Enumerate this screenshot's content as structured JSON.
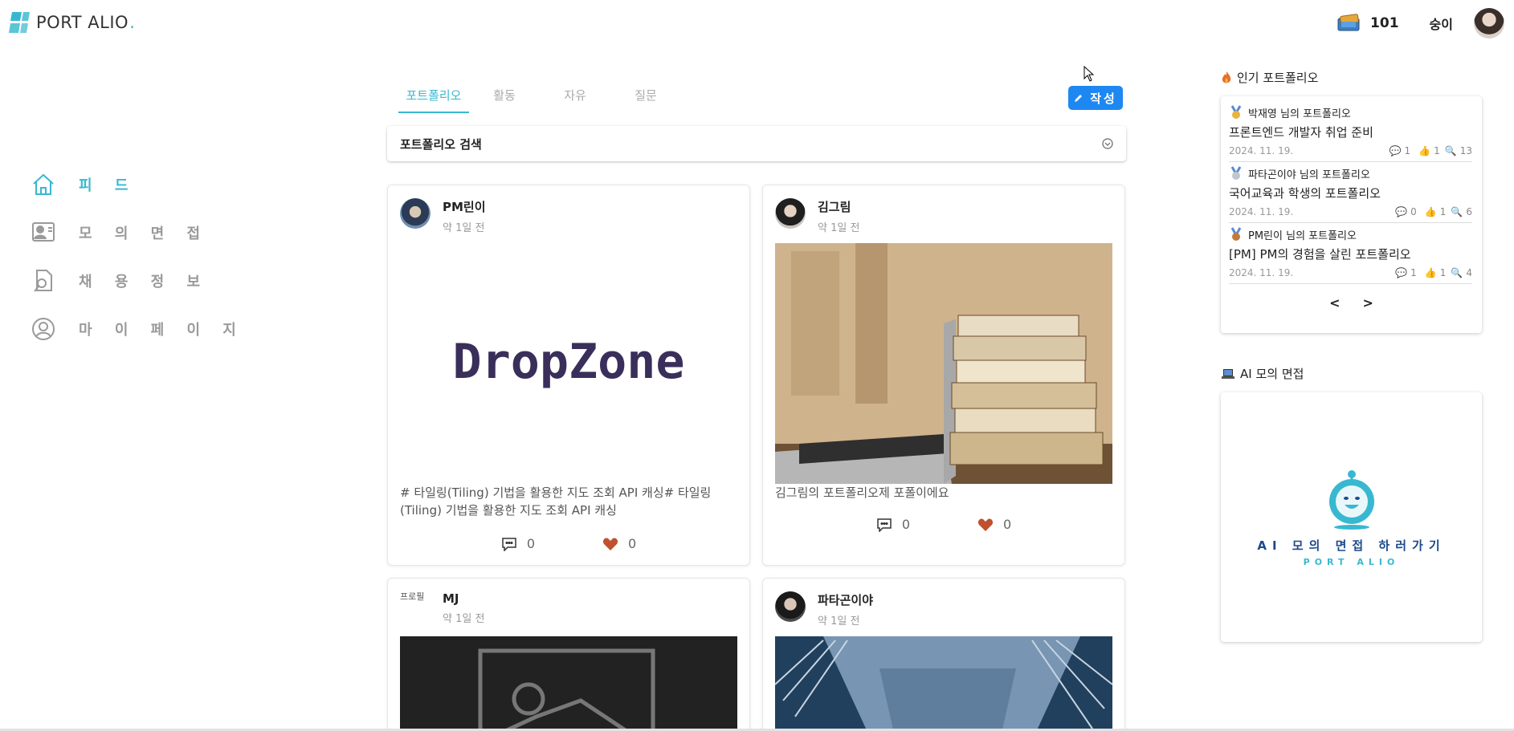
{
  "header": {
    "logo_text": "PORT ALIO",
    "logo_dot": ".",
    "coin_count": "101",
    "username": "숭이"
  },
  "sidebar": {
    "items": [
      {
        "label": "피 드",
        "icon": "home-icon",
        "active": true
      },
      {
        "label": "모 의 면 접",
        "icon": "interview-icon",
        "active": false
      },
      {
        "label": "채 용 정 보",
        "icon": "job-search-icon",
        "active": false
      },
      {
        "label": "마 이 페 이 지",
        "icon": "user-icon",
        "active": false
      }
    ]
  },
  "tabs": [
    "포트폴리오",
    "활동",
    "자유",
    "질문"
  ],
  "write_button": "작성",
  "search": {
    "title": "포트폴리오 검색"
  },
  "cards": [
    {
      "author": "PM린이",
      "time": "약 1일 전",
      "image_text": "DropZone",
      "description": "# 타일링(Tiling) 기법을 활용한 지도 조회 API 캐싱# 타일링(Tiling) 기법을 활용한 지도 조회 API 캐싱",
      "comments": "0",
      "likes": "0"
    },
    {
      "author": "김그림",
      "time": "약 1일 전",
      "description": "김그림의 포트폴리오제 포폴이에요",
      "comments": "0",
      "likes": "0"
    },
    {
      "author": "MJ",
      "time": "약 1일 전",
      "avatar_alt": "프로필"
    },
    {
      "author": "파타곤이야",
      "time": "약 1일 전"
    }
  ],
  "popular": {
    "title": "인기 포트폴리오",
    "items": [
      {
        "medal": "1",
        "owner": "박재영 님의 포트폴리오",
        "title": "프론트엔드 개발자 취업 준비",
        "date": "2024. 11. 19.",
        "comments": "1",
        "likes": "1",
        "views": "13"
      },
      {
        "medal": "2",
        "owner": "파타곤이야 님의 포트폴리오",
        "title": "국어교육과 학생의 포트폴리오",
        "date": "2024. 11. 19.",
        "comments": "0",
        "likes": "1",
        "views": "6"
      },
      {
        "medal": "3",
        "owner": "PM린이 님의 포트폴리오",
        "title": "[PM] PM의 경험을 살린 포트폴리오",
        "date": "2024. 11. 19.",
        "comments": "1",
        "likes": "1",
        "views": "4"
      }
    ],
    "prev": "<",
    "next": ">"
  },
  "ai_interview": {
    "title": "AI 모의 면접",
    "caption": "AI 모의 면접 하러가기",
    "sub": "PORT ALIO"
  },
  "colors": {
    "accent": "#38b8d0",
    "button": "#1d88f2",
    "heart": "#c0502e"
  }
}
